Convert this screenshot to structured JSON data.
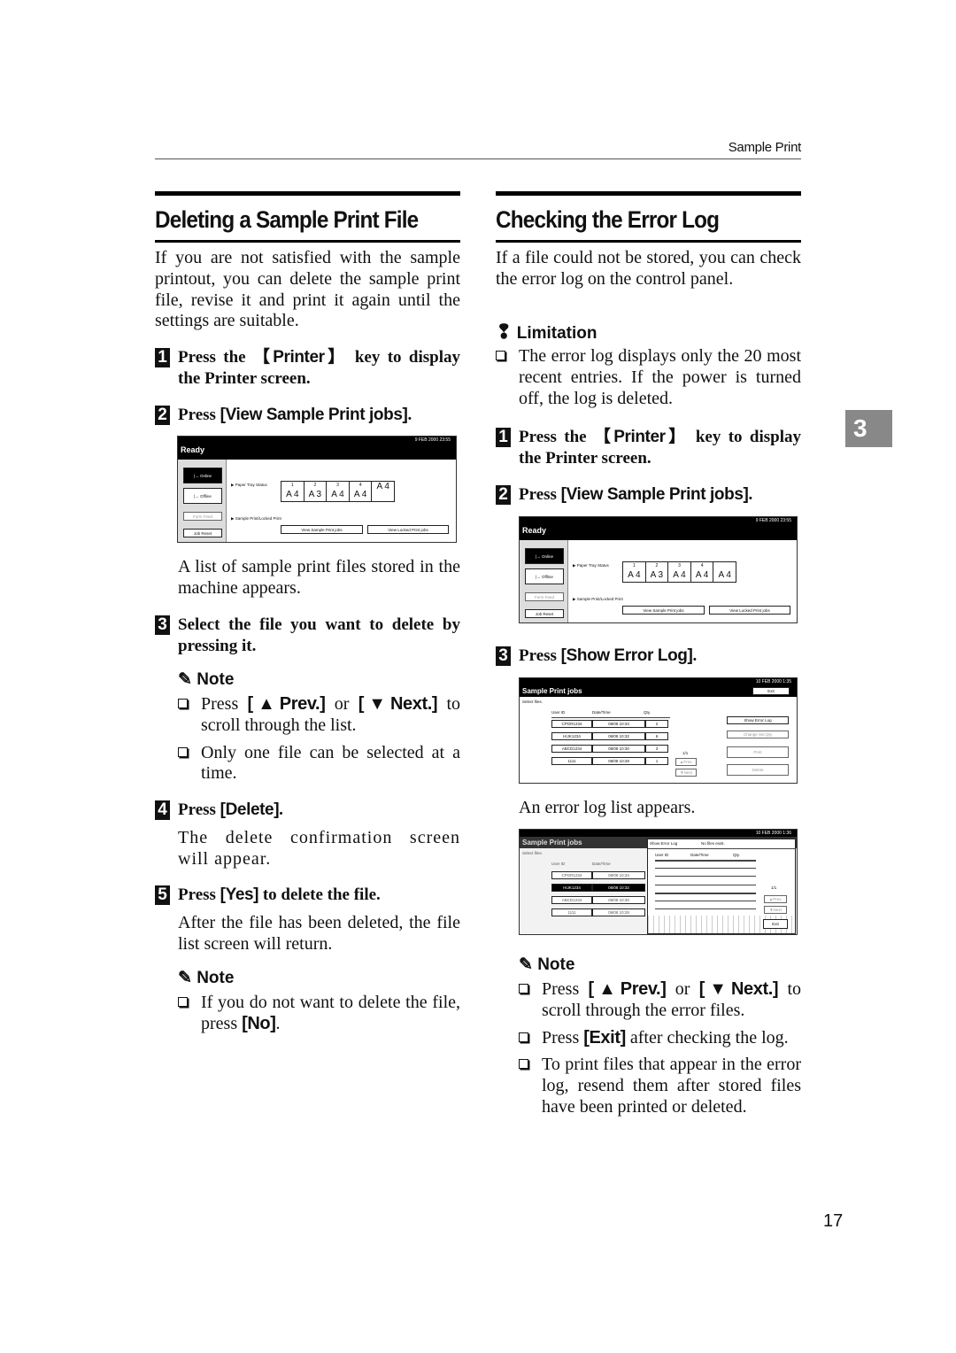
{
  "running_head": "Sample Print",
  "page_number": "17",
  "chapter_tab": "3",
  "left": {
    "title": "Deleting a Sample Print File",
    "intro": "If you are not satisfied with the sample printout, you can delete the sample print file, revise it and print it again until the settings are suitable.",
    "steps": [
      {
        "num": "1",
        "pre": "Press the ",
        "key": "【Printer】",
        "post": " key to display the Printer screen."
      },
      {
        "num": "2",
        "pre": "Press ",
        "key": "[View Sample Print jobs]",
        "post": "."
      },
      {
        "num": "3",
        "pre": "Select the file you want to delete by pressing it.",
        "key": "",
        "post": ""
      },
      {
        "num": "4",
        "pre": "Press ",
        "key": "[Delete]",
        "post": "."
      },
      {
        "num": "5",
        "pre": "Press ",
        "key": "[Yes]",
        "post": " to delete the file."
      }
    ],
    "after_step2": "A list of sample print files stored in the machine appears.",
    "note1": {
      "heading": "Note",
      "items": [
        {
          "pre": "Press ",
          "k1": "[▲Prev.]",
          "mid": " or ",
          "k2": "[▼Next.]",
          "post": " to scroll through the list."
        },
        {
          "text": "Only one file can be selected at a time."
        }
      ]
    },
    "after_step4": "The delete confirmation screen will appear.",
    "after_step5": "After the file has been deleted, the file list screen will return.",
    "note2": {
      "heading": "Note",
      "items": [
        {
          "pre": "If you do not want to delete the file, press ",
          "k1": "[No]",
          "post": "."
        }
      ]
    }
  },
  "right": {
    "title": "Checking the Error Log",
    "intro": "If a file could not be stored, you can check the error log on the control panel.",
    "limitation": {
      "heading": "Limitation",
      "items": [
        "The error log displays only the 20 most recent entries. If the power is turned off, the log is deleted."
      ]
    },
    "steps": [
      {
        "num": "1",
        "pre": "Press the ",
        "key": "【Printer】",
        "post": " key to display the Printer screen."
      },
      {
        "num": "2",
        "pre": "Press ",
        "key": "[View Sample Print jobs]",
        "post": "."
      },
      {
        "num": "3",
        "pre": "Press ",
        "key": "[Show Error Log]",
        "post": "."
      }
    ],
    "after_step3": "An error log list appears.",
    "note": {
      "heading": "Note",
      "items": [
        {
          "pre": "Press ",
          "k1": "[▲Prev.]",
          "mid": " or ",
          "k2": "[▼Next.]",
          "post": " to scroll through the error files."
        },
        {
          "pre": "Press ",
          "k1": "[Exit]",
          "post": " after checking the log."
        },
        {
          "text": "To print files that appear in the error log, resend them after stored files have been printed or deleted."
        }
      ]
    }
  },
  "screen_ready": {
    "datetime": "9  FEB   2000 23:55",
    "status": "Ready",
    "side_buttons": [
      "|→ Online",
      "|→ Offline",
      "Form Feed",
      "Job Reset"
    ],
    "paper_tray_label": "▶ Paper Tray Status",
    "trays": [
      {
        "num": "1",
        "size": "A 4"
      },
      {
        "num": "2",
        "size": "A 3"
      },
      {
        "num": "3",
        "size": "A 4"
      },
      {
        "num": "4",
        "size": "A 4"
      },
      {
        "num": "",
        "size": "A 4"
      }
    ],
    "sample_label": "▶ Sample Print/Locked Print",
    "view_sample": "View Sample Print jobs",
    "view_locked": "View Locked Print jobs"
  },
  "screen_jobs": {
    "datetime": "10  FEB   2000   1:35",
    "title": "Sample Print jobs",
    "exit": "Exit",
    "select_label": "Select files.",
    "columns": [
      "User ID",
      "Date/Time",
      "Qty."
    ],
    "rows": [
      {
        "user": "CPGR1234",
        "time": "08/08  10:34",
        "qty": "2"
      },
      {
        "user": "HIJK1234",
        "time": "08/08  10:32",
        "qty": "6"
      },
      {
        "user": "ABCD1234",
        "time": "08/08  10:30",
        "qty": "3"
      },
      {
        "user": "1111",
        "time": "08/08  10:28",
        "qty": "1"
      }
    ],
    "page": "1/1",
    "prev": "▲Prev.",
    "next": "▼Next",
    "show_error_log": "Show Error Log",
    "change_qty": "Change Set Qty",
    "print": "Print",
    "delete": "Delete"
  },
  "screen_errorlog": {
    "datetime": "10  FEB   2000   1:36",
    "title": "Sample Print jobs",
    "select_label": "Select files.",
    "bg_columns": [
      "User ID",
      "Date/Time"
    ],
    "bg_rows": [
      {
        "user": "CPGR1234",
        "time": "08/08  10:34"
      },
      {
        "user": "HIJK1234",
        "time": "08/08  10:32"
      },
      {
        "user": "ABCD1234",
        "time": "08/08  10:30"
      },
      {
        "user": "1111",
        "time": "08/08  10:28"
      }
    ],
    "dialog_title": "Show Error Log",
    "dialog_message": "No files exist.",
    "columns": [
      "User ID",
      "Date/Time",
      "Qty."
    ],
    "page": "1/1",
    "prev": "▲Prev.",
    "next": "▼Next",
    "exit": "Exit"
  }
}
